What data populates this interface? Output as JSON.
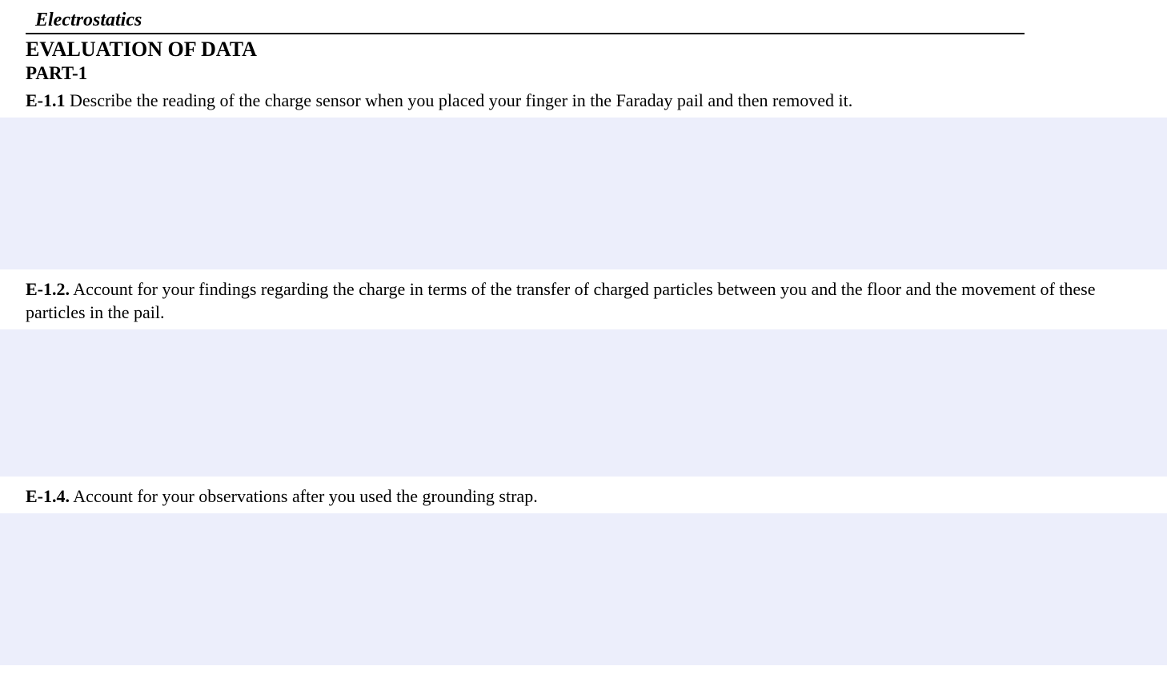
{
  "header": {
    "title": "Electrostatics"
  },
  "section": {
    "title": "EVALUATION OF DATA",
    "part": "PART-1"
  },
  "questions": [
    {
      "number": "E-1.1",
      "text": " Describe the reading of the charge sensor when you placed your finger in the Faraday pail and then removed it."
    },
    {
      "number": "E-1.2.",
      "text": "   Account for your findings regarding the charge in terms of the transfer of charged particles between you and the floor and the movement of these particles in the pail."
    },
    {
      "number": "E-1.4.",
      "text": "  Account for your observations after you used the grounding strap."
    }
  ]
}
